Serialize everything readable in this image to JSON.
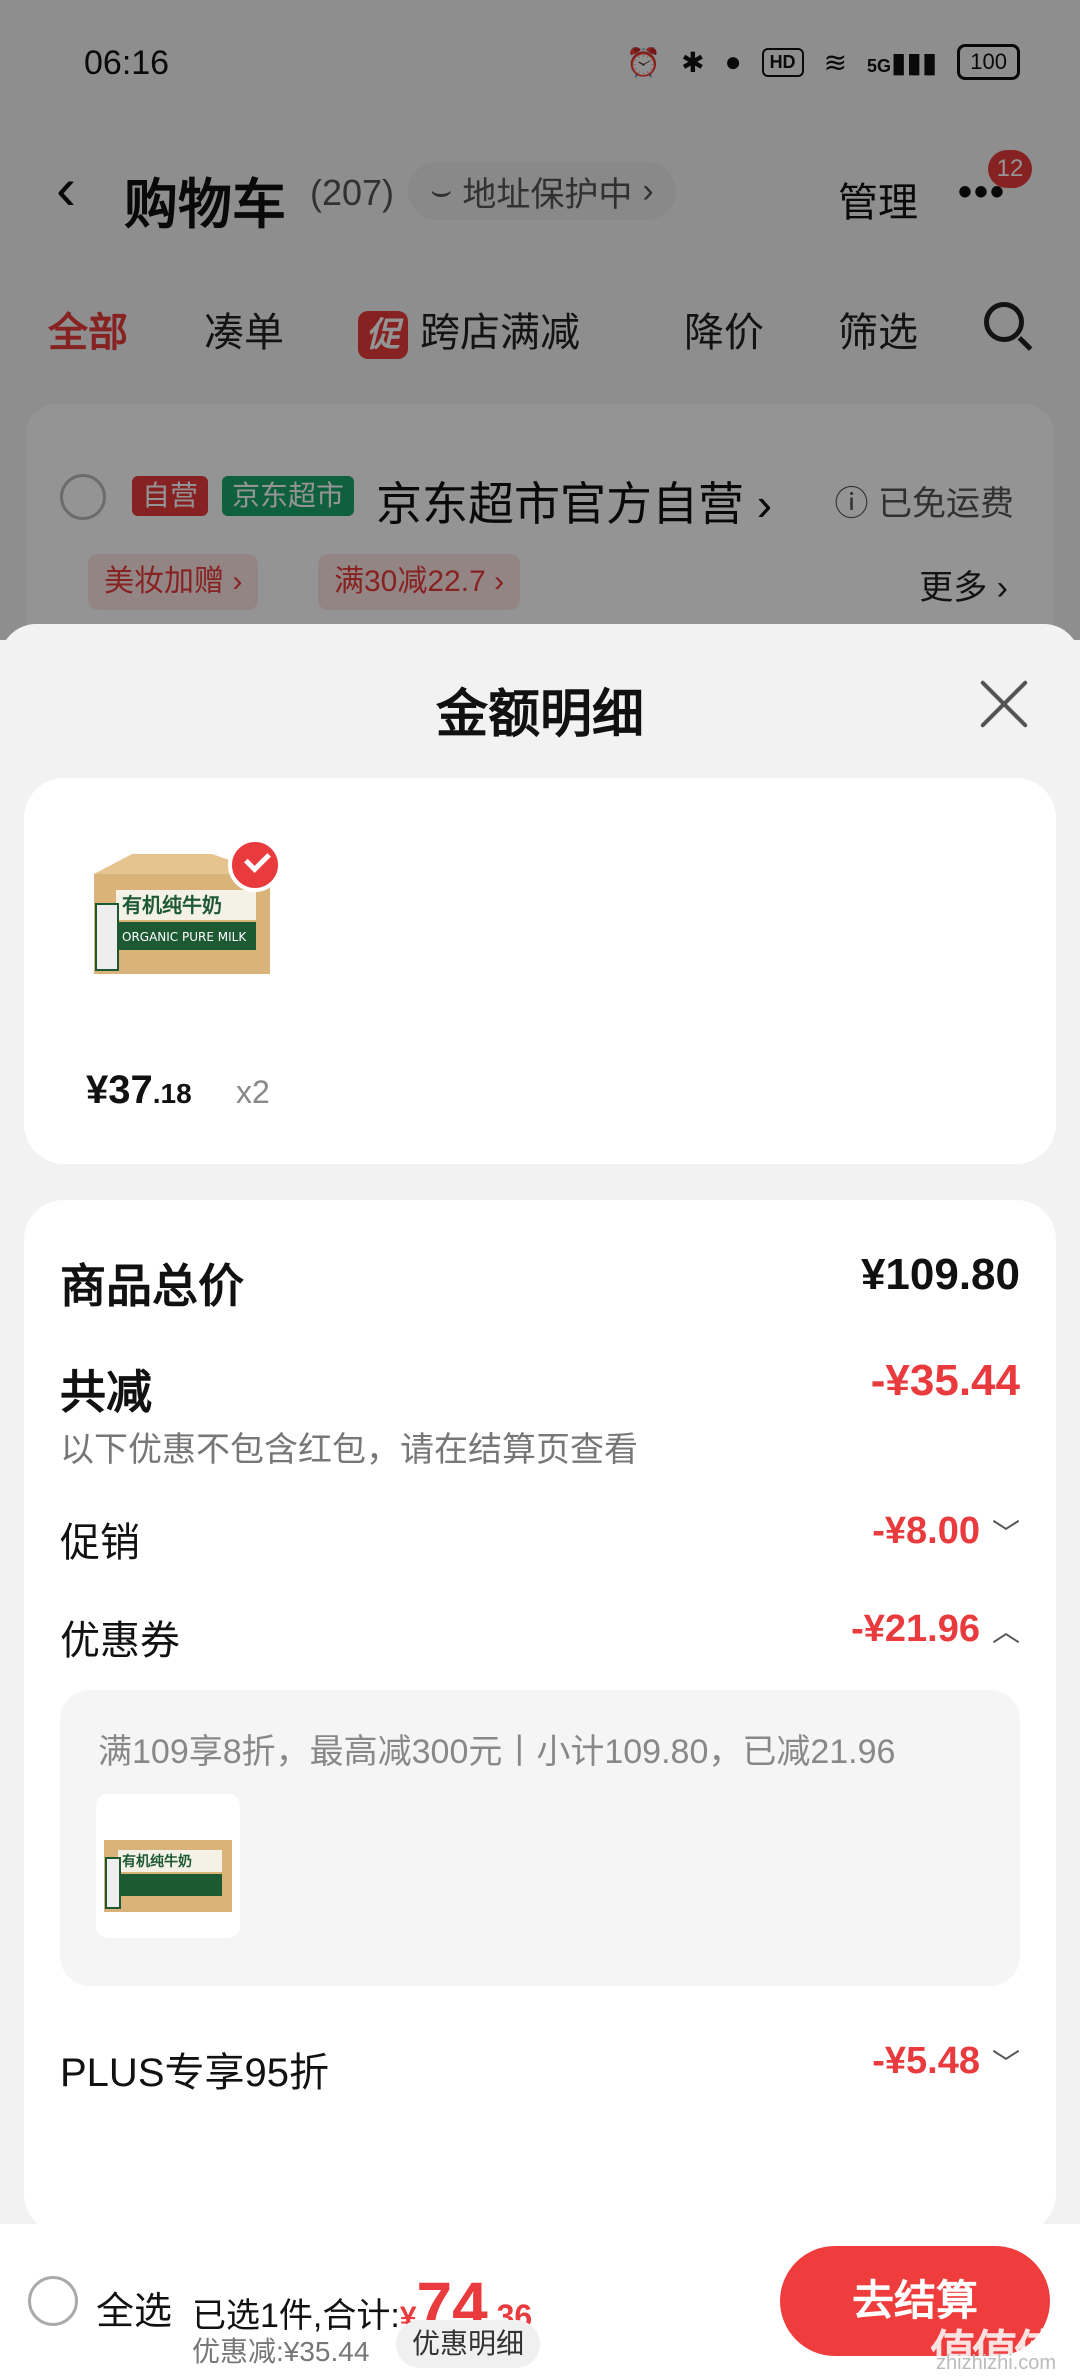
{
  "status_bar": {
    "time": "06:16",
    "icons": [
      "alarm-icon",
      "bluetooth-icon",
      "location-icon",
      "hd-icon",
      "wifi-icon",
      "signal-5g-icon",
      "battery-icon"
    ],
    "hd": "HD",
    "net": "5G",
    "battery": "100"
  },
  "nav": {
    "back_icon": "chevron-left-icon",
    "title": "购物车",
    "count": "(207)",
    "address_protect": "地址保护中",
    "manage": "管理",
    "more_icon": "more-dots-icon",
    "badge": "12"
  },
  "tabs": [
    {
      "label": "全部",
      "active": true
    },
    {
      "label": "凑单"
    },
    {
      "label": "跨店满减",
      "tag": "促"
    },
    {
      "label": "降价"
    },
    {
      "label": "筛选"
    }
  ],
  "store": {
    "tag_self": "自营",
    "tag_mart": "京东超市",
    "name": "京东超市官方自营",
    "free_shipping": "已免运费",
    "chips": [
      "美妆加赠",
      "满30减22.7"
    ],
    "more": "更多"
  },
  "sheet": {
    "title": "金额明细",
    "product": {
      "price_int": "¥37",
      "price_dec": ".18",
      "qty": "x2",
      "package_text": "有机纯牛奶",
      "package_sub": "ORGANIC PURE MILK"
    },
    "total_label": "商品总价",
    "total_value": "¥109.80",
    "reduce_label": "共减",
    "reduce_value": "-¥35.44",
    "reduce_note": "以下优惠不包含红包，请在结算页查看",
    "promo_label": "促销",
    "promo_value": "-¥8.00",
    "coupon_label": "优惠券",
    "coupon_value": "-¥21.96",
    "coupon_detail": "满109享8折，最高减300元丨小计109.80，已减21.96",
    "plus_label": "PLUS专享95折",
    "plus_value": "-¥5.48"
  },
  "bottom": {
    "select_all": "全选",
    "selected_text": "已选1件,合计:",
    "currency": "¥",
    "total_int": "74",
    "total_dec": ".36",
    "discount": "优惠减:¥35.44",
    "discount_detail": "优惠明细",
    "checkout": "去结算"
  },
  "watermark": {
    "text": "值值值",
    "sub": "zhizhizhi.com"
  },
  "colors": {
    "accent": "#e93b3d",
    "mart_green": "#1aa56a",
    "sheet_bg": "#f2f2f2"
  }
}
